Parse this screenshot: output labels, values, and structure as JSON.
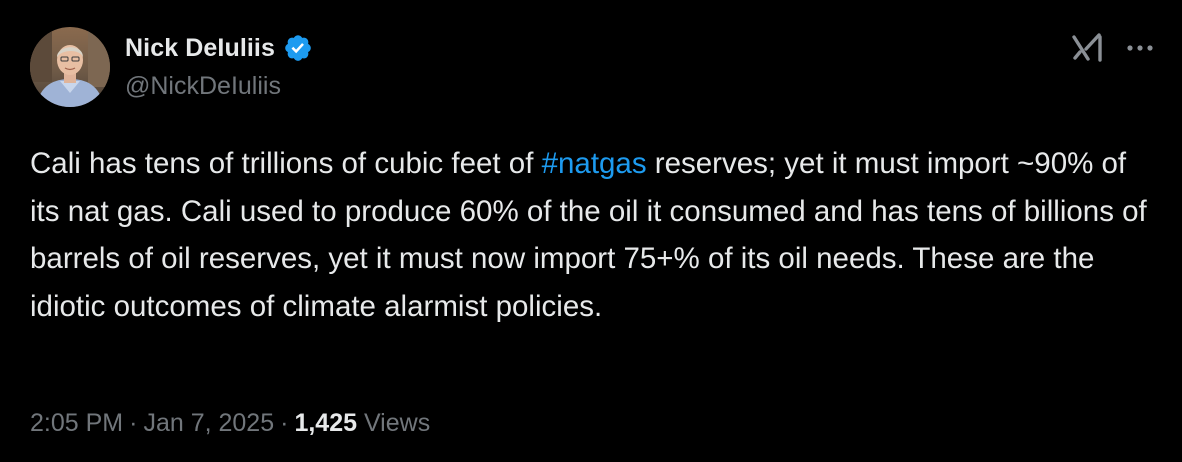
{
  "author": {
    "display_name": "Nick DeIuliis",
    "handle": "@NickDeIuliis",
    "verified_color": "#1d9bf0"
  },
  "header_icons": {
    "grok": "grok-icon",
    "more": "more-horizontal-icon"
  },
  "tweet": {
    "text_before": "Cali has tens of trillions of cubic feet of ",
    "hashtag": "#natgas",
    "text_after": " reserves; yet it must import ~90% of its nat gas. Cali used to produce 60% of the oil it consumed and has tens of billions of barrels of oil reserves, yet it must now import 75+% of its oil needs. These are the idiotic outcomes of climate alarmist policies."
  },
  "meta": {
    "time": "2:05 PM",
    "separator": "·",
    "date": "Jan 7, 2025",
    "views_count": "1,425",
    "views_label": "Views"
  },
  "colors": {
    "background": "#000000",
    "text_primary": "#e7e9ea",
    "text_secondary": "#71767b",
    "link": "#1d9bf0"
  }
}
